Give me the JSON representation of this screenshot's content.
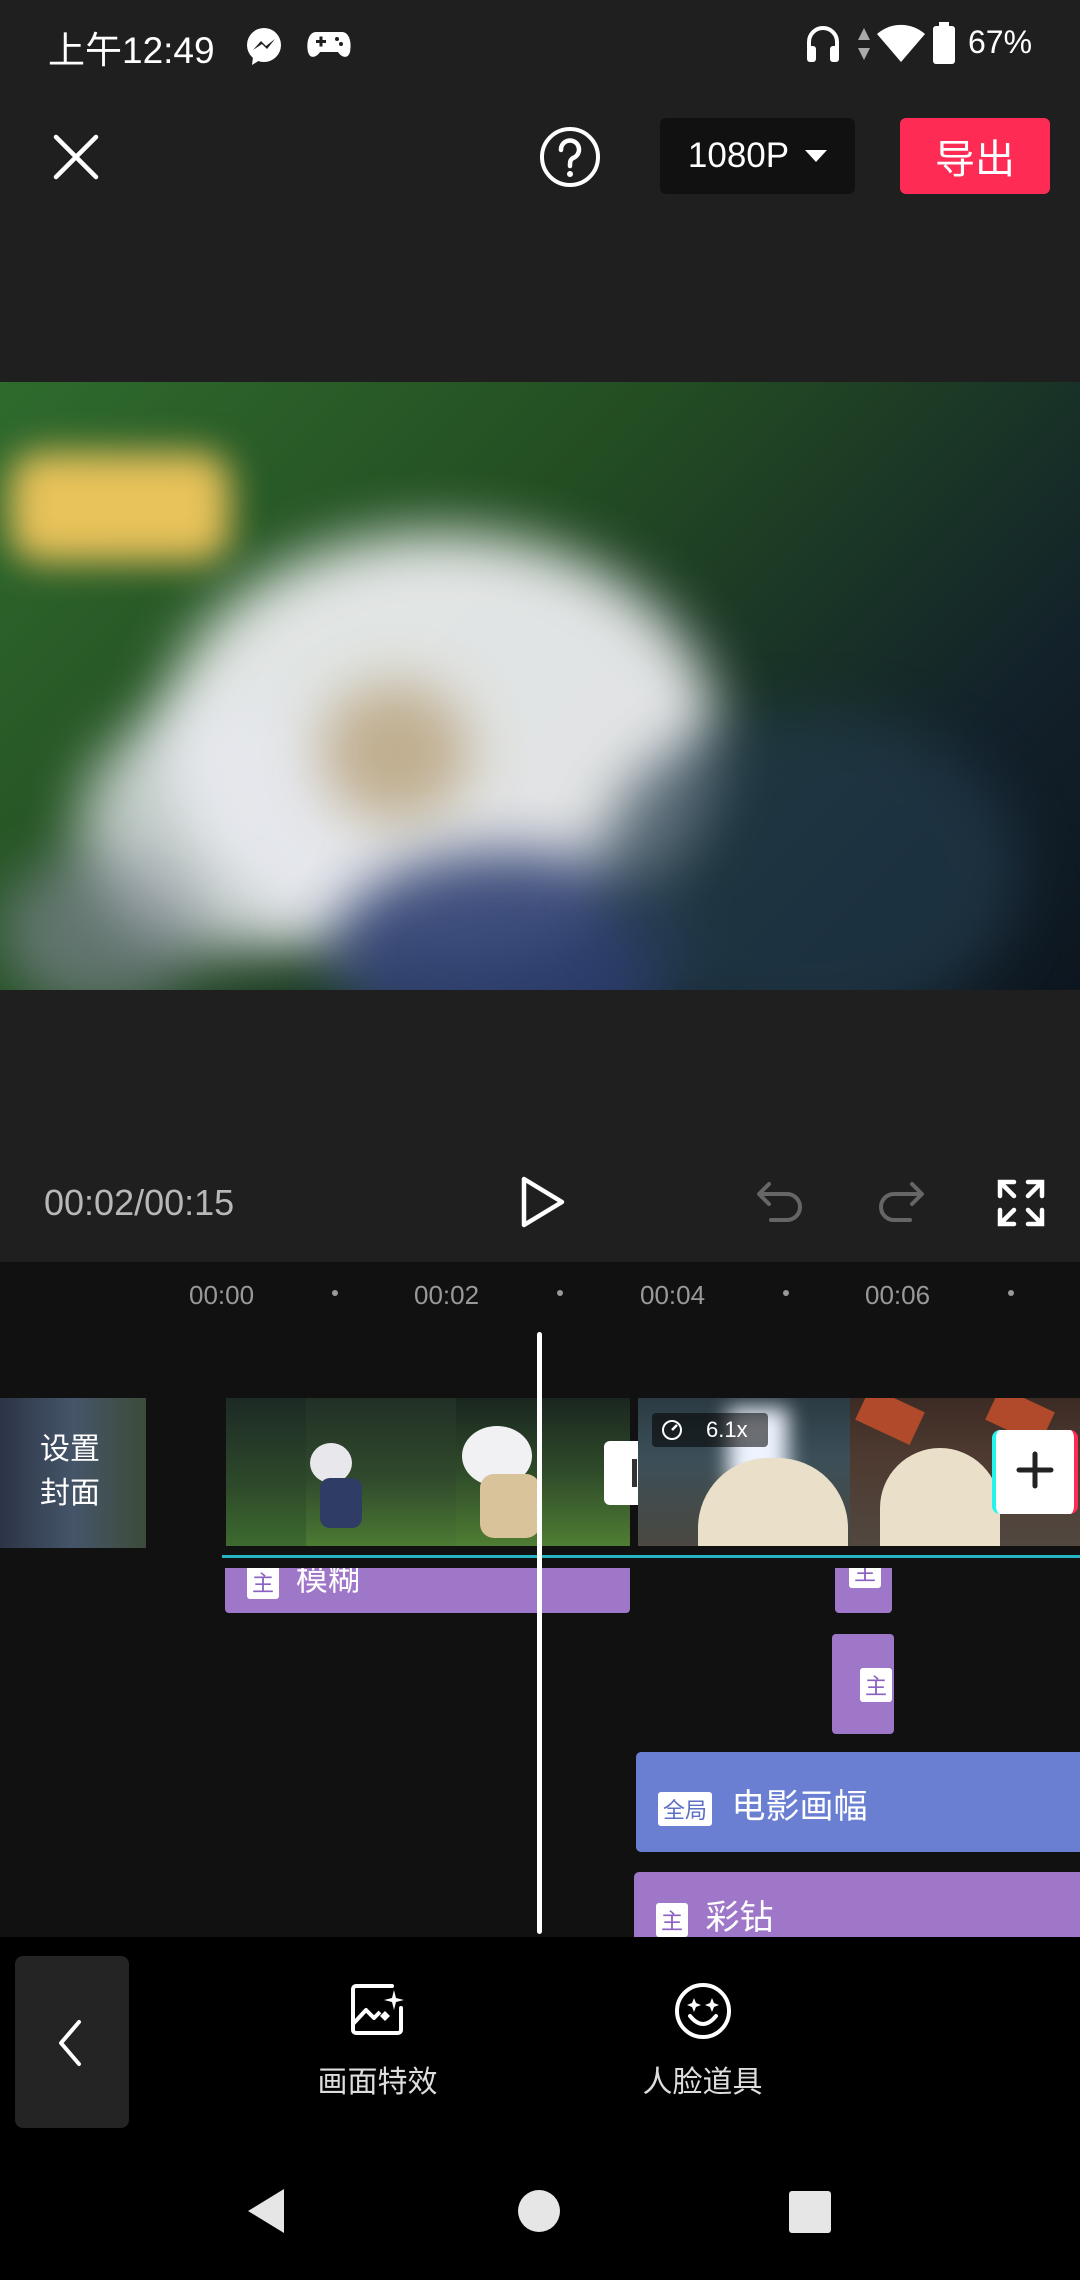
{
  "status_bar": {
    "time": "上午12:49",
    "battery": "67%"
  },
  "top_bar": {
    "resolution": "1080P",
    "export_label": "导出"
  },
  "player": {
    "time": "00:02/00:15"
  },
  "timeline": {
    "ticks": [
      "00:00",
      "00:02",
      "00:04",
      "00:06"
    ],
    "cover_label_1": "设置",
    "cover_label_2": "封面",
    "speed": "6.1x",
    "tracks": {
      "blur_chip": "主",
      "blur_label": "模糊",
      "small_chip_1": "主",
      "small_chip_2": "主",
      "movie_chip": "全局",
      "movie_label": "电影画幅",
      "diamond_chip": "主",
      "diamond_label": "彩钻"
    }
  },
  "toolbar": {
    "effects_label": "画面特效",
    "face_props_label": "人脸道具"
  },
  "colors": {
    "accent": "#fe2c55",
    "effect_purple": "#9f77c9",
    "global_blue": "#6b7fd2"
  }
}
